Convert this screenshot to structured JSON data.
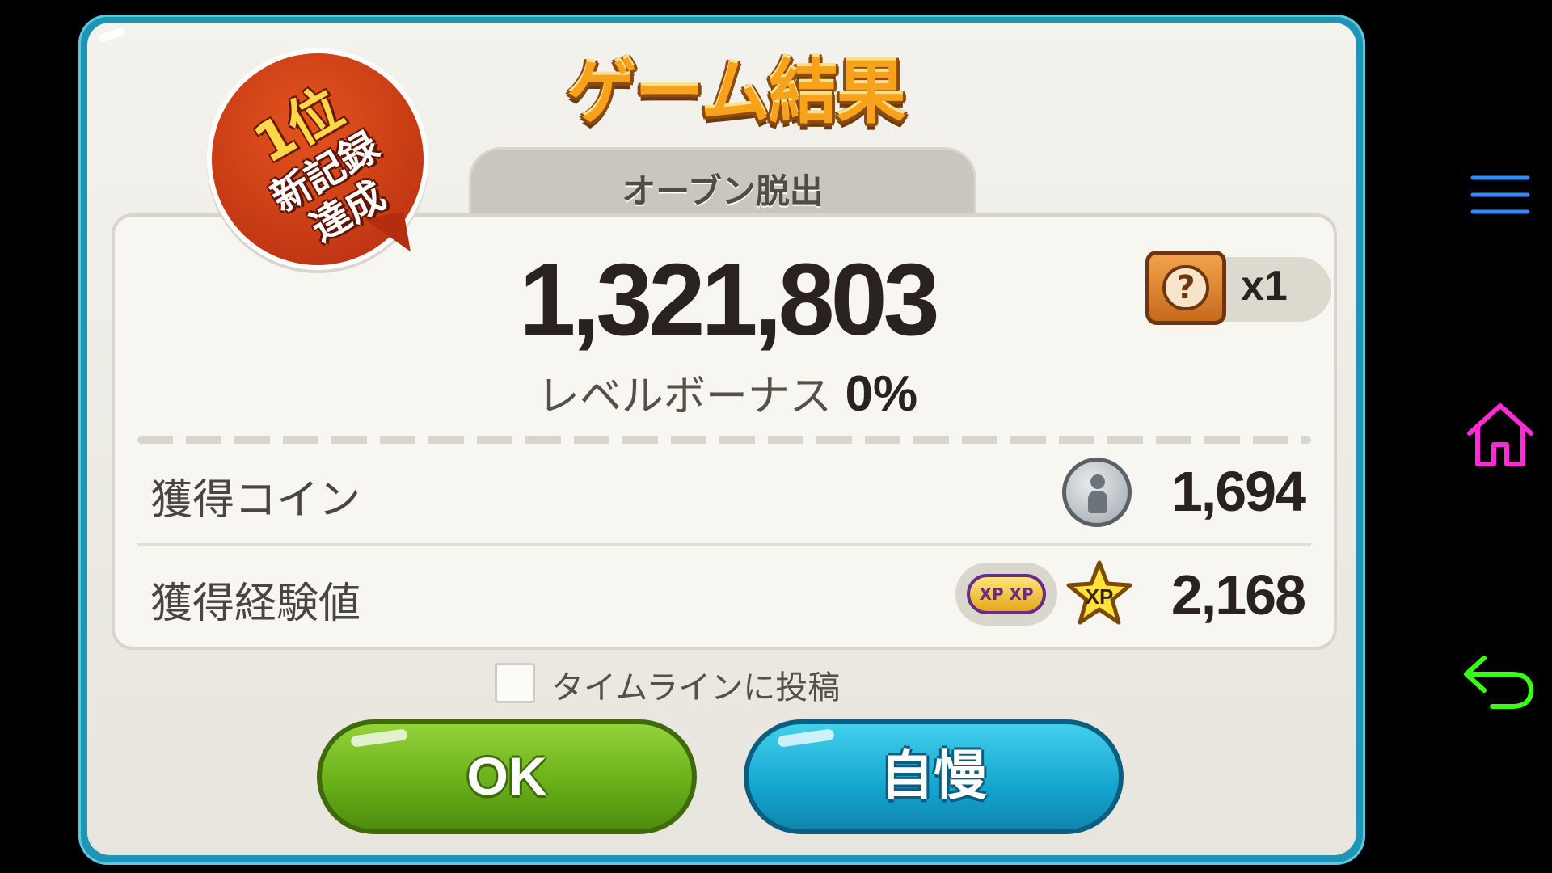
{
  "dialog": {
    "title": "ゲーム結果",
    "mode_tab": "オーブン脱出",
    "rank_badge": {
      "place": "1位",
      "record_line1": "新記録",
      "record_line2": "達成"
    },
    "score": "1,321,803",
    "level_bonus_label": "レベルボーナス",
    "level_bonus_value": "0%",
    "item_box": {
      "icon": "mystery-box-icon",
      "glyph": "?",
      "quantity": "x1"
    },
    "rows": [
      {
        "label": "獲得コイン",
        "icon": "silver-coin-icon",
        "value": "1,694"
      },
      {
        "label": "獲得経験値",
        "icons": [
          "xp-boost-icon",
          "xp-star-icon"
        ],
        "boost_text": "XP XP",
        "star_text": "XP",
        "value": "2,168"
      }
    ],
    "timeline_checkbox": {
      "label": "タイムラインに投稿",
      "checked": false
    },
    "buttons": {
      "ok": "OK",
      "boast": "自慢"
    }
  },
  "system_nav": {
    "menu_icon": "menu-icon",
    "home_icon": "home-icon",
    "back_icon": "back-icon"
  },
  "colors": {
    "frame": "#1e95b4",
    "title": "#f7a21a",
    "ok_button": "#66ad17",
    "boast_button": "#14a5cf",
    "rank_badge": "#c9360f",
    "nav_menu": "#2f8cff",
    "nav_home": "#ff2bd6",
    "nav_back": "#39ff14"
  }
}
